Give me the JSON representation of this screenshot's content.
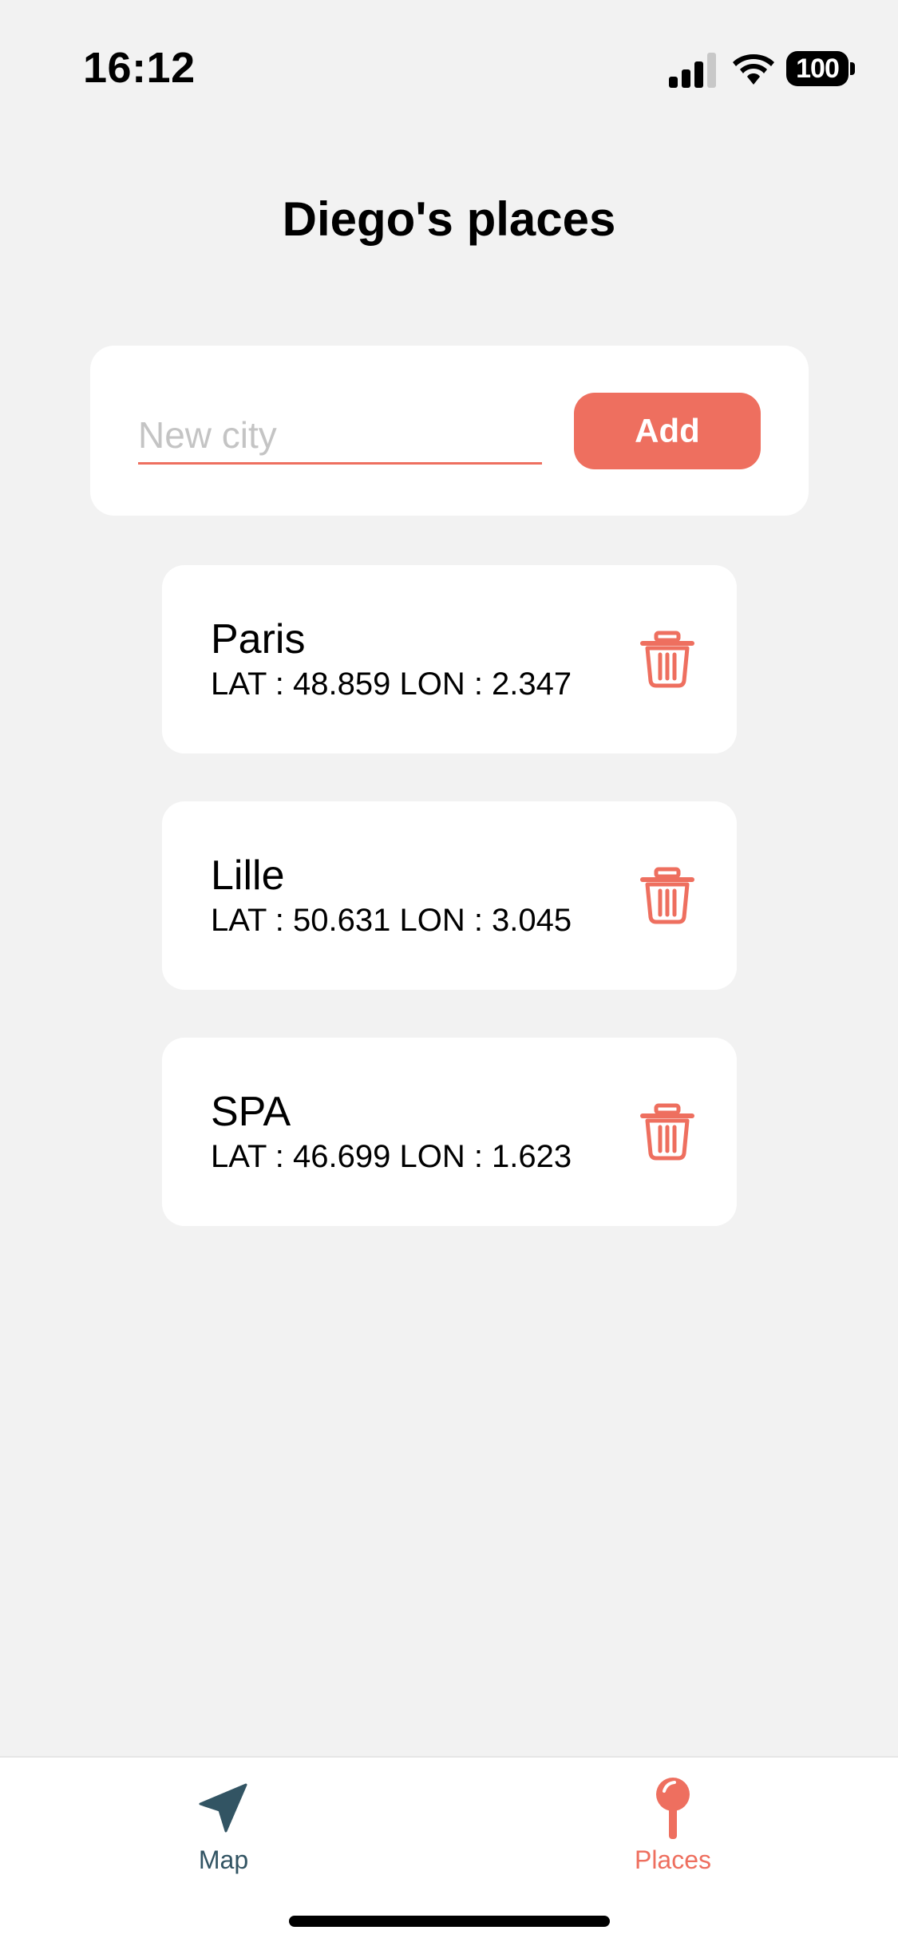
{
  "status_bar": {
    "time": "16:12",
    "battery_level": "100",
    "icons": [
      "cellular-signal-icon",
      "wifi-icon",
      "battery-icon"
    ]
  },
  "header": {
    "title": "Diego's places"
  },
  "add_form": {
    "input_placeholder": "New city",
    "input_value": "",
    "add_label": "Add"
  },
  "places": [
    {
      "name": "Paris",
      "coords": "LAT : 48.859 LON : 2.347"
    },
    {
      "name": "Lille",
      "coords": "LAT : 50.631 LON : 3.045"
    },
    {
      "name": "SPA",
      "coords": "LAT : 46.699 LON : 1.623"
    }
  ],
  "tab_bar": {
    "tabs": [
      {
        "label": "Map",
        "icon": "navigation-arrow-icon",
        "active": false
      },
      {
        "label": "Places",
        "icon": "map-pin-icon",
        "active": true
      }
    ]
  },
  "colors": {
    "accent": "#ee6f5f",
    "map_tab": "#325463",
    "background": "#f2f2f2",
    "card": "#ffffff"
  }
}
